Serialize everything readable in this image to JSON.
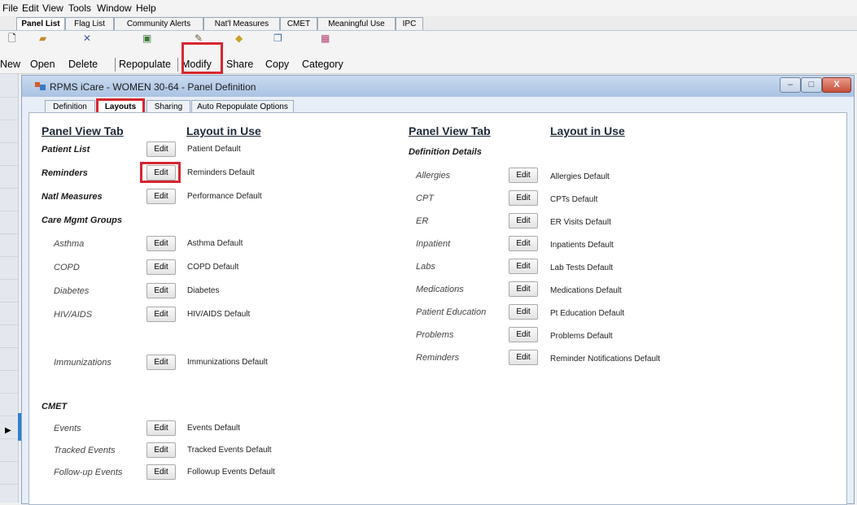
{
  "menu": [
    "File",
    "Edit",
    "View",
    "Tools",
    "Window",
    "Help"
  ],
  "main_tabs": [
    "Panel List",
    "Flag List",
    "Community Alerts",
    "Nat'l Measures",
    "CMET",
    "Meaningful Use",
    "IPC"
  ],
  "toolbar": {
    "new": "New",
    "open": "Open",
    "delete": "Delete",
    "repopulate": "Repopulate",
    "modify": "Modify",
    "share": "Share",
    "copy": "Copy",
    "category": "Category"
  },
  "window": {
    "title": "RPMS iCare - WOMEN 30-64 - Panel Definition",
    "minimize": "–",
    "maximize": "□",
    "close": "X"
  },
  "def_tabs": [
    "Definition",
    "Layouts",
    "Sharing",
    "Auto Repopulate Options"
  ],
  "headers": {
    "panel_view_tab": "Panel View Tab",
    "layout_in_use": "Layout in Use"
  },
  "edit_label": "Edit",
  "left_rows": [
    {
      "label": "Patient List",
      "layout": "Patient Default"
    },
    {
      "label": "Reminders",
      "layout": "Reminders Default"
    },
    {
      "label": "Natl Measures",
      "layout": "Performance Default"
    },
    {
      "label": "Care Mgmt Groups"
    },
    {
      "label": "Asthma",
      "layout": "Asthma Default"
    },
    {
      "label": "COPD",
      "layout": "COPD Default"
    },
    {
      "label": "Diabetes",
      "layout": "Diabetes"
    },
    {
      "label": "HIV/AIDS",
      "layout": "HIV/AIDS Default"
    },
    {
      "label": "Immunizations",
      "layout": "Immunizations Default"
    },
    {
      "label": "CMET"
    },
    {
      "label": "Events",
      "layout": "Events Default"
    },
    {
      "label": "Tracked Events",
      "layout": "Tracked Events Default"
    },
    {
      "label": "Follow-up Events",
      "layout": "Followup Events Default"
    }
  ],
  "right_section": "Definition Details",
  "right_rows": [
    {
      "label": "Allergies",
      "layout": "Allergies Default"
    },
    {
      "label": "CPT",
      "layout": "CPTs Default"
    },
    {
      "label": "ER",
      "layout": "ER Visits Default"
    },
    {
      "label": "Inpatient",
      "layout": "Inpatients Default"
    },
    {
      "label": "Labs",
      "layout": "Lab Tests Default"
    },
    {
      "label": "Medications",
      "layout": "Medications Default"
    },
    {
      "label": "Patient Education",
      "layout": "Pt Education Default"
    },
    {
      "label": "Problems",
      "layout": "Problems Default"
    },
    {
      "label": "Reminders",
      "layout": "Reminder Notifications Default"
    }
  ],
  "colors": {
    "highlight": "#d7262e",
    "title_bar": "#aac2e2"
  }
}
